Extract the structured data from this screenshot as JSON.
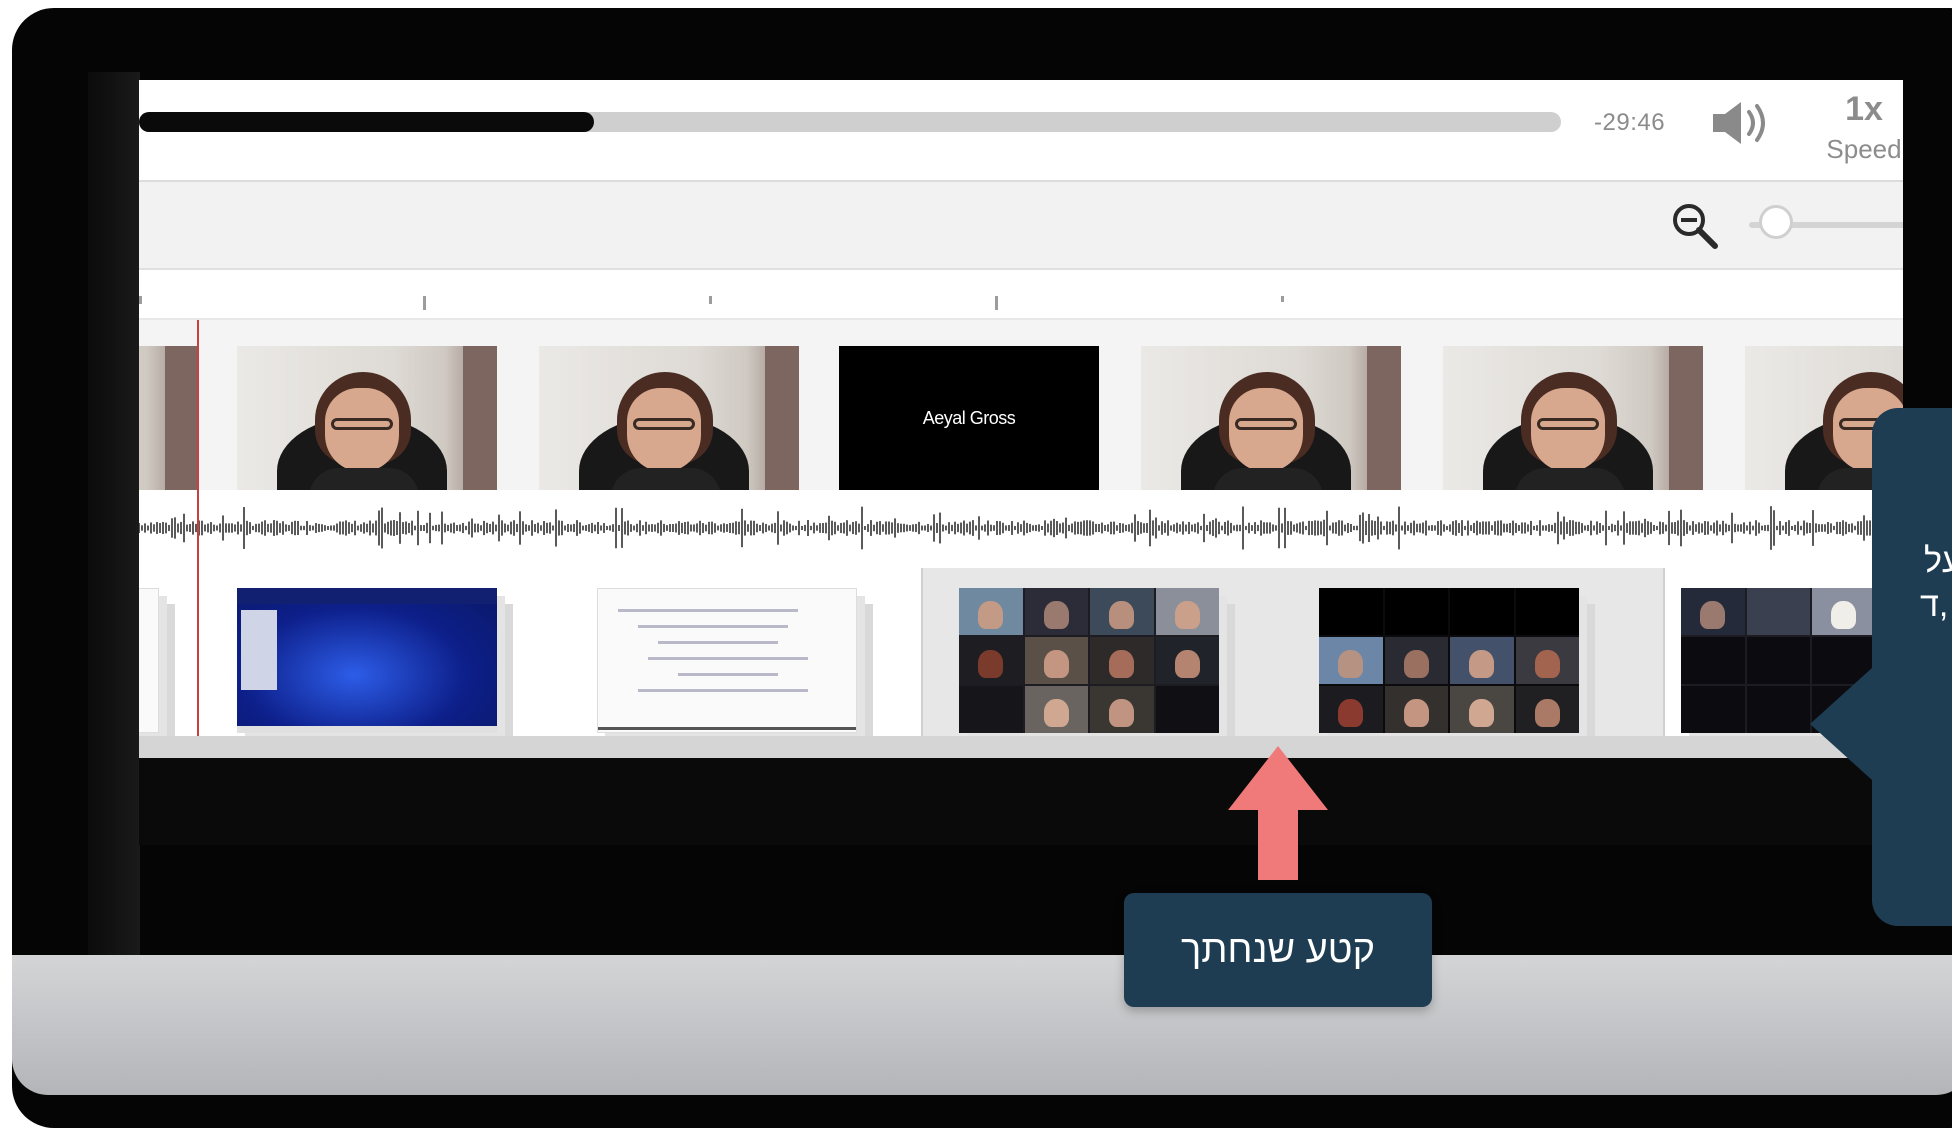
{
  "player": {
    "time_remaining": "-29:46",
    "speed_value": "1x",
    "speed_label": "Speed",
    "progress": 0.32,
    "volume_icon": "volume-icon",
    "progress_color": "#0a0a0a"
  },
  "toolbar": {
    "zoom_icon": "zoom-out-icon",
    "zoom_level": 0.05
  },
  "timeline": {
    "video_frames": [
      "face",
      "face",
      "name",
      "face",
      "face",
      "face"
    ],
    "name_frame_label": "Aeyal Gross",
    "screen_slides": [
      "blue",
      "doc",
      "grid",
      "darkgrid",
      "grid"
    ]
  },
  "callouts": {
    "bottom_text": "קטע שנחתך",
    "right_text_line1": "על",
    "right_text_line2": "ד,",
    "accent": "#1e3d52",
    "arrow_color": "#f07a7a"
  }
}
